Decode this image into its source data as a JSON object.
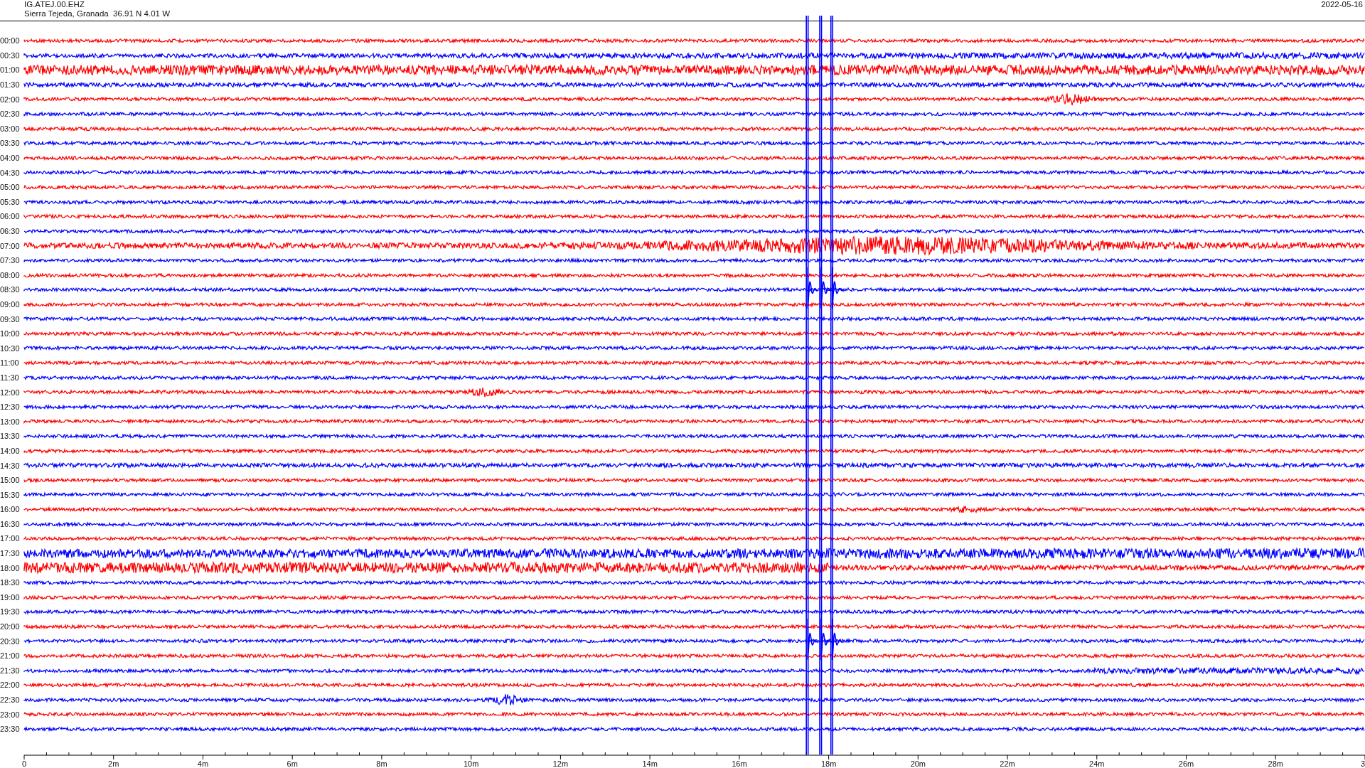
{
  "header": {
    "station": "IG.ATEJ.00.EHZ",
    "location": "Sierra Tejeda, Granada  36.91 N 4.01 W",
    "date": "2022-05-16"
  },
  "traces": [
    {
      "time": "00:00",
      "color": "#ff0000"
    },
    {
      "time": "00:30",
      "color": "#0000ff"
    },
    {
      "time": "01:00",
      "color": "#ff0000"
    },
    {
      "time": "01:30",
      "color": "#0000ff"
    },
    {
      "time": "02:00",
      "color": "#ff0000"
    },
    {
      "time": "02:30",
      "color": "#0000ff"
    },
    {
      "time": "03:00",
      "color": "#ff0000"
    },
    {
      "time": "03:30",
      "color": "#0000ff"
    },
    {
      "time": "04:00",
      "color": "#ff0000"
    },
    {
      "time": "04:30",
      "color": "#0000ff"
    },
    {
      "time": "05:00",
      "color": "#ff0000"
    },
    {
      "time": "05:30",
      "color": "#0000ff"
    },
    {
      "time": "06:00",
      "color": "#ff0000"
    },
    {
      "time": "06:30",
      "color": "#0000ff"
    },
    {
      "time": "07:00",
      "color": "#ff0000"
    },
    {
      "time": "07:30",
      "color": "#0000ff"
    },
    {
      "time": "08:00",
      "color": "#ff0000"
    },
    {
      "time": "08:30",
      "color": "#0000ff"
    },
    {
      "time": "09:00",
      "color": "#ff0000"
    },
    {
      "time": "09:30",
      "color": "#0000ff"
    },
    {
      "time": "10:00",
      "color": "#ff0000"
    },
    {
      "time": "10:30",
      "color": "#0000ff"
    },
    {
      "time": "11:00",
      "color": "#ff0000"
    },
    {
      "time": "11:30",
      "color": "#0000ff"
    },
    {
      "time": "12:00",
      "color": "#ff0000"
    },
    {
      "time": "12:30",
      "color": "#0000ff"
    },
    {
      "time": "13:00",
      "color": "#ff0000"
    },
    {
      "time": "13:30",
      "color": "#0000ff"
    },
    {
      "time": "14:00",
      "color": "#ff0000"
    },
    {
      "time": "14:30",
      "color": "#0000ff"
    },
    {
      "time": "15:00",
      "color": "#ff0000"
    },
    {
      "time": "15:30",
      "color": "#0000ff"
    },
    {
      "time": "16:00",
      "color": "#ff0000"
    },
    {
      "time": "16:30",
      "color": "#0000ff"
    },
    {
      "time": "17:00",
      "color": "#ff0000"
    },
    {
      "time": "17:30",
      "color": "#0000ff"
    },
    {
      "time": "18:00",
      "color": "#ff0000"
    },
    {
      "time": "18:30",
      "color": "#0000ff"
    },
    {
      "time": "19:00",
      "color": "#ff0000"
    },
    {
      "time": "19:30",
      "color": "#0000ff"
    },
    {
      "time": "20:00",
      "color": "#ff0000"
    },
    {
      "time": "20:30",
      "color": "#0000ff"
    },
    {
      "time": "21:00",
      "color": "#ff0000"
    },
    {
      "time": "21:30",
      "color": "#0000ff"
    },
    {
      "time": "22:00",
      "color": "#ff0000"
    },
    {
      "time": "22:30",
      "color": "#0000ff"
    },
    {
      "time": "23:00",
      "color": "#ff0000"
    },
    {
      "time": "23:30",
      "color": "#0000ff"
    }
  ],
  "x_axis": {
    "labels": [
      "0",
      "2m",
      "4m",
      "6m",
      "8m",
      "10m",
      "12m",
      "14m",
      "16m",
      "18m",
      "20m",
      "22m",
      "24m",
      "26m",
      "28m",
      "3"
    ]
  }
}
